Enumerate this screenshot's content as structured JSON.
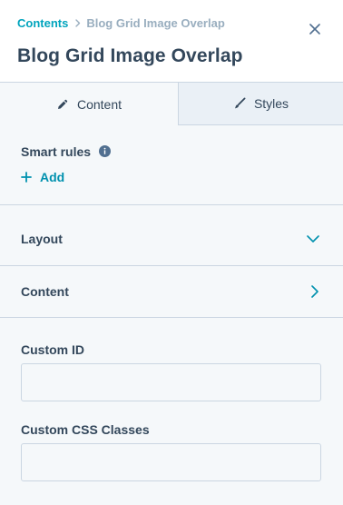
{
  "breadcrumb": {
    "parent": "Contents",
    "current": "Blog Grid Image Overlap"
  },
  "header": {
    "title": "Blog Grid Image Overlap"
  },
  "tabs": [
    {
      "label": "Content",
      "icon": "pencil-icon",
      "active": true
    },
    {
      "label": "Styles",
      "icon": "brush-icon",
      "active": false
    }
  ],
  "smart_rules": {
    "label": "Smart rules",
    "add_label": "Add"
  },
  "sections": {
    "layout": {
      "label": "Layout",
      "icon": "chevron-down-icon"
    },
    "content": {
      "label": "Content",
      "icon": "chevron-right-icon"
    }
  },
  "fields": {
    "custom_id": {
      "label": "Custom ID",
      "value": "",
      "placeholder": ""
    },
    "custom_css": {
      "label": "Custom CSS Classes",
      "value": "",
      "placeholder": ""
    }
  },
  "colors": {
    "accent": "#00a4bd",
    "link": "#0091ae",
    "text": "#33475b",
    "muted": "#99aebf",
    "border": "#cbd6e2",
    "background": "#f5f8fa"
  }
}
